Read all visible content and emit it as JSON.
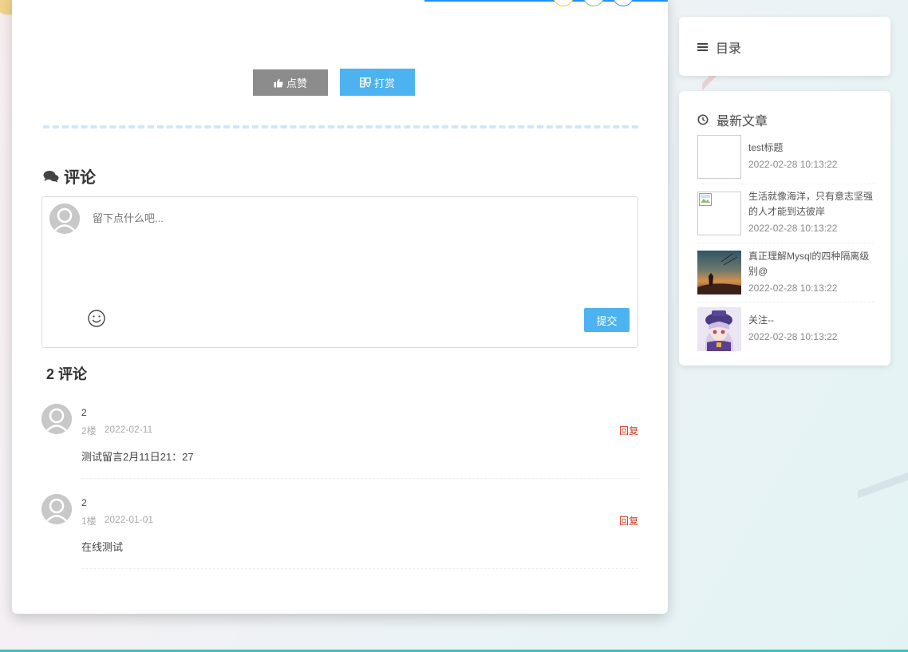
{
  "actions": {
    "like_label": "点赞",
    "reward_label": "打赏"
  },
  "comments_section": {
    "heading": "评论",
    "input_placeholder": "留下点什么吧...",
    "submit_label": "提交",
    "count_heading": "2 评论",
    "items": [
      {
        "name": "2",
        "floor": "2楼",
        "date": "2022-02-11",
        "reply": "回复",
        "text": "测试留言2月11日21：27"
      },
      {
        "name": "2",
        "floor": "1楼",
        "date": "2022-01-01",
        "reply": "回复",
        "text": "在线测试"
      }
    ]
  },
  "sidebar": {
    "toc": {
      "title": "目录",
      "icon": "list-icon"
    },
    "latest": {
      "title": "最新文章",
      "icon": "clock-icon",
      "posts": [
        {
          "title": "test标题",
          "date": "2022-02-28 10:13:22",
          "thumb": "blank"
        },
        {
          "title": "生活就像海洋，只有意志坚强的人才能到达彼岸",
          "date": "2022-02-28 10:13:22",
          "thumb": "broken-image"
        },
        {
          "title": "真正理解Mysql的四种隔离级别@",
          "date": "2022-02-28 10:13:22",
          "thumb": "sunset-scene"
        },
        {
          "title": "关注--",
          "date": "2022-02-28 10:13:22",
          "thumb": "anime-girl"
        }
      ]
    }
  },
  "colors": {
    "accent_blue": "#4db3f0",
    "like_gray": "#8c8c8c",
    "reply_red": "#d9361e",
    "bottom_line": "#3bbfbf"
  }
}
